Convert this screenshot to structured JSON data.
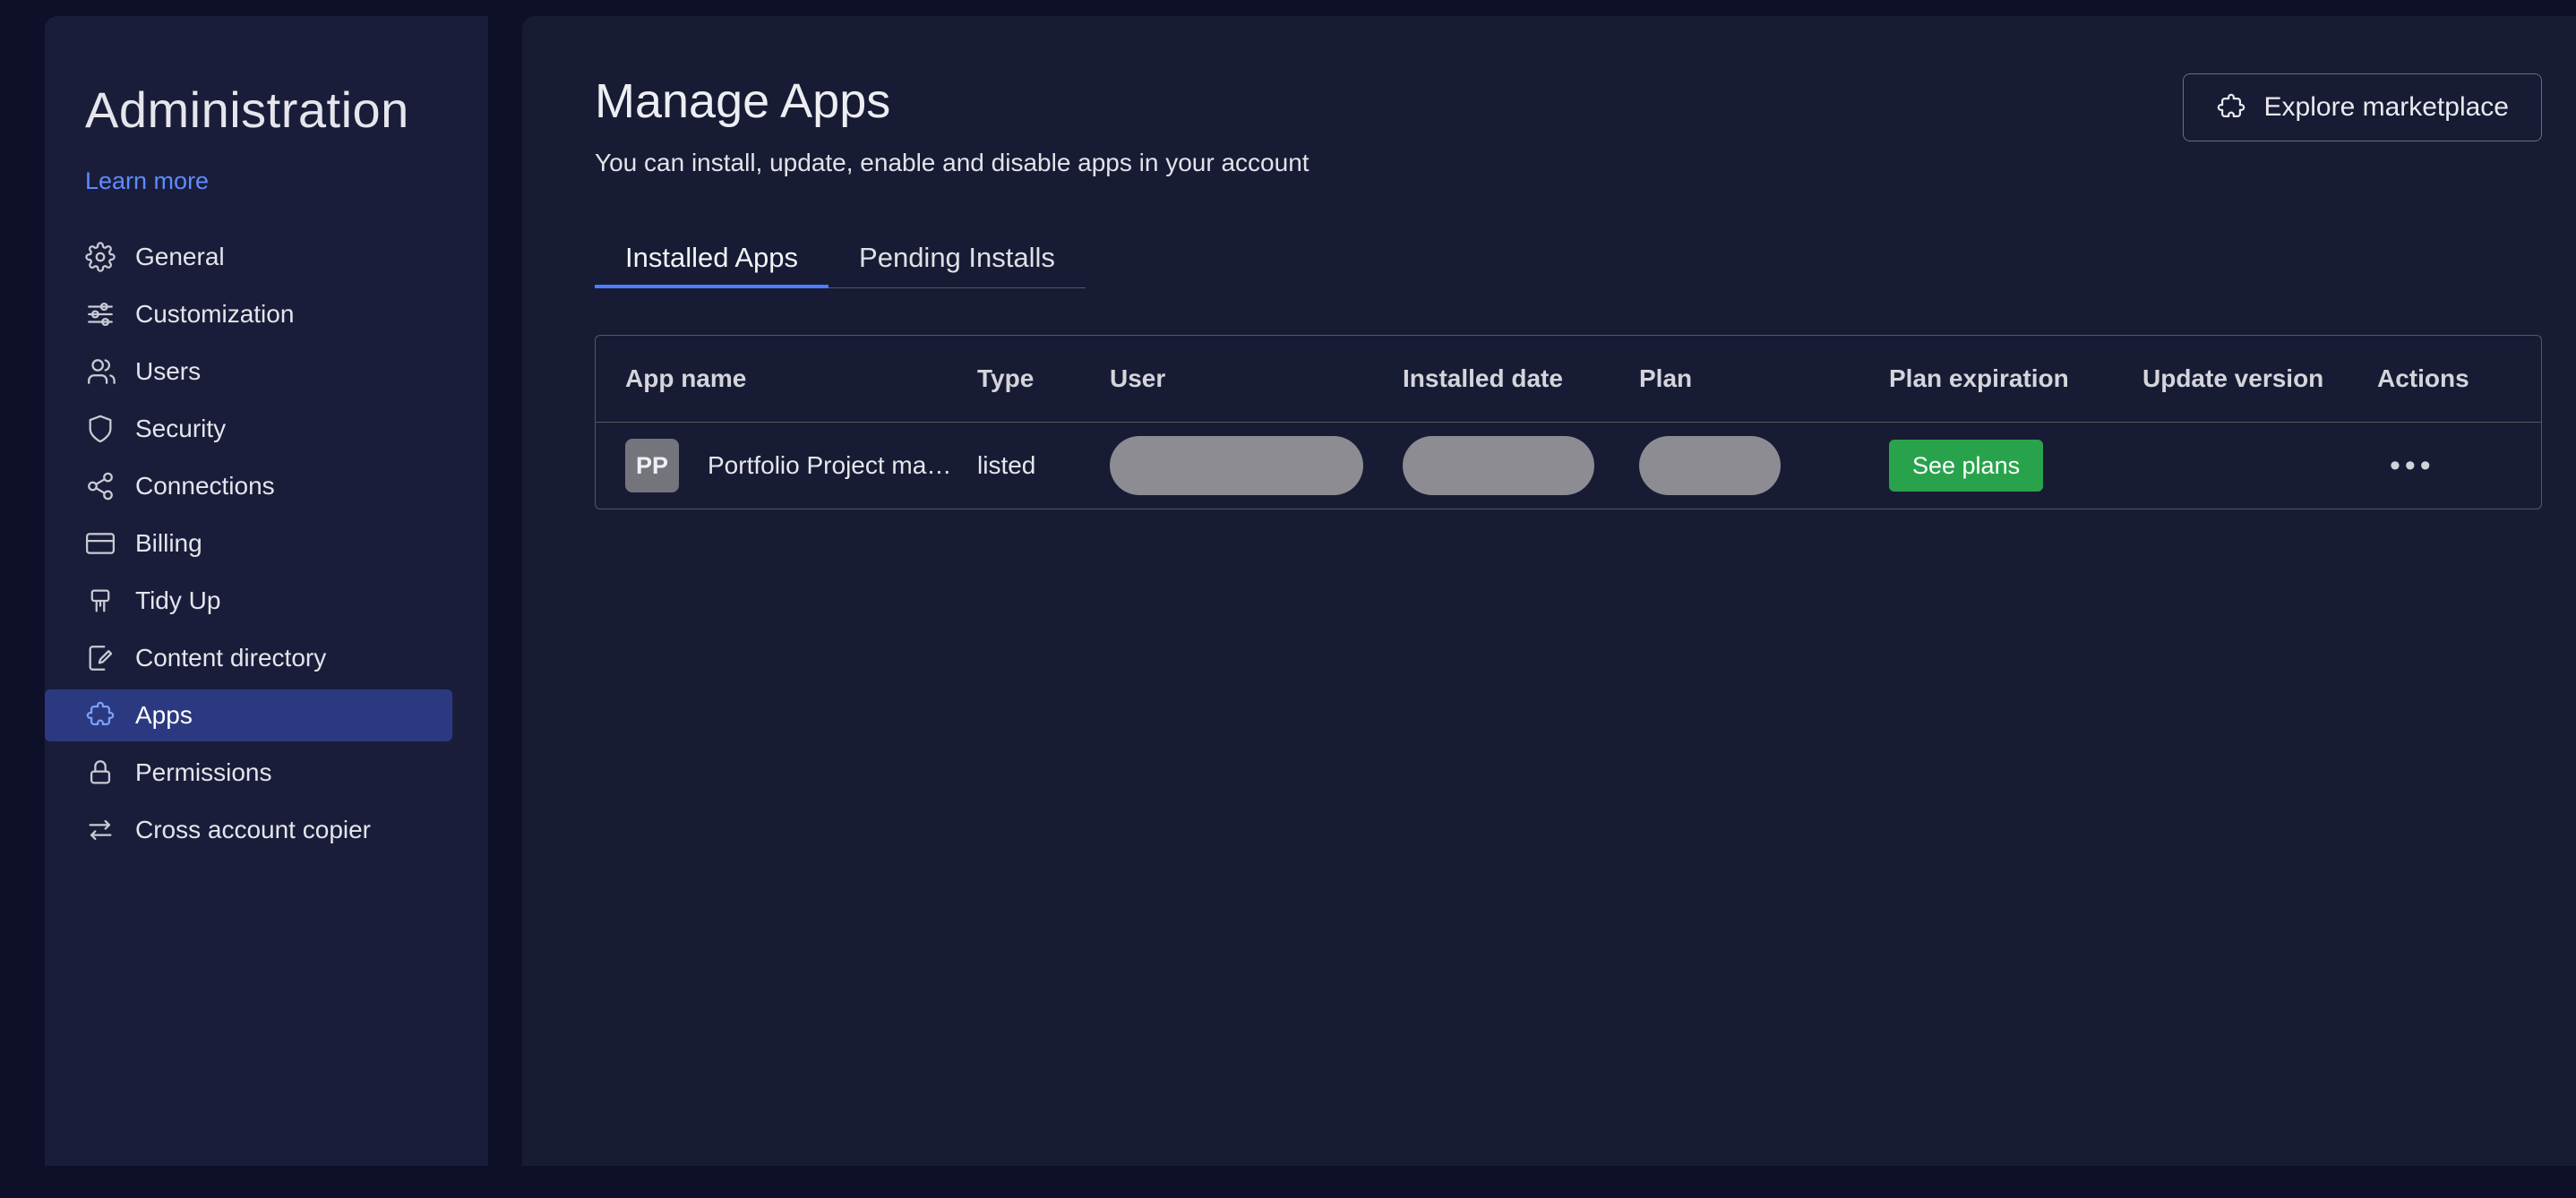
{
  "sidebar": {
    "title": "Administration",
    "learn_more": "Learn more",
    "items": [
      {
        "label": "General",
        "icon": "gear-icon"
      },
      {
        "label": "Customization",
        "icon": "sliders-icon"
      },
      {
        "label": "Users",
        "icon": "users-icon"
      },
      {
        "label": "Security",
        "icon": "shield-icon"
      },
      {
        "label": "Connections",
        "icon": "connections-icon"
      },
      {
        "label": "Billing",
        "icon": "credit-card-icon"
      },
      {
        "label": "Tidy Up",
        "icon": "tidy-up-icon"
      },
      {
        "label": "Content directory",
        "icon": "document-pencil-icon"
      },
      {
        "label": "Apps",
        "icon": "puzzle-icon",
        "selected": true
      },
      {
        "label": "Permissions",
        "icon": "lock-icon"
      },
      {
        "label": "Cross account copier",
        "icon": "transfer-arrows-icon"
      }
    ]
  },
  "header": {
    "title": "Manage Apps",
    "subtitle": "You can install, update, enable and disable apps in your account",
    "explore_button": "Explore marketplace"
  },
  "tabs": [
    {
      "label": "Installed Apps",
      "active": true
    },
    {
      "label": "Pending Installs",
      "active": false
    }
  ],
  "table": {
    "columns": [
      "App name",
      "Type",
      "User",
      "Installed date",
      "Plan",
      "Plan expiration",
      "Update version",
      "Actions"
    ],
    "rows": [
      {
        "avatar": "PP",
        "name": "Portfolio Project ma…",
        "type": "listed",
        "user": "(redacted)",
        "installed_date": "(redacted)",
        "plan": "(redacted)",
        "plan_expiration_button": "See plans",
        "update_version": "",
        "actions_icon": "•••"
      }
    ]
  },
  "colors": {
    "page_frame": "#0e1029",
    "sidebar_bg": "#1a1d3a",
    "content_bg": "#181b34",
    "accent_blue": "#4e7cff",
    "link_blue": "#5d8bff",
    "selected_item_bg": "#2b3a80",
    "green_button": "#28a34c",
    "redacted_pill": "#8c8c92"
  }
}
